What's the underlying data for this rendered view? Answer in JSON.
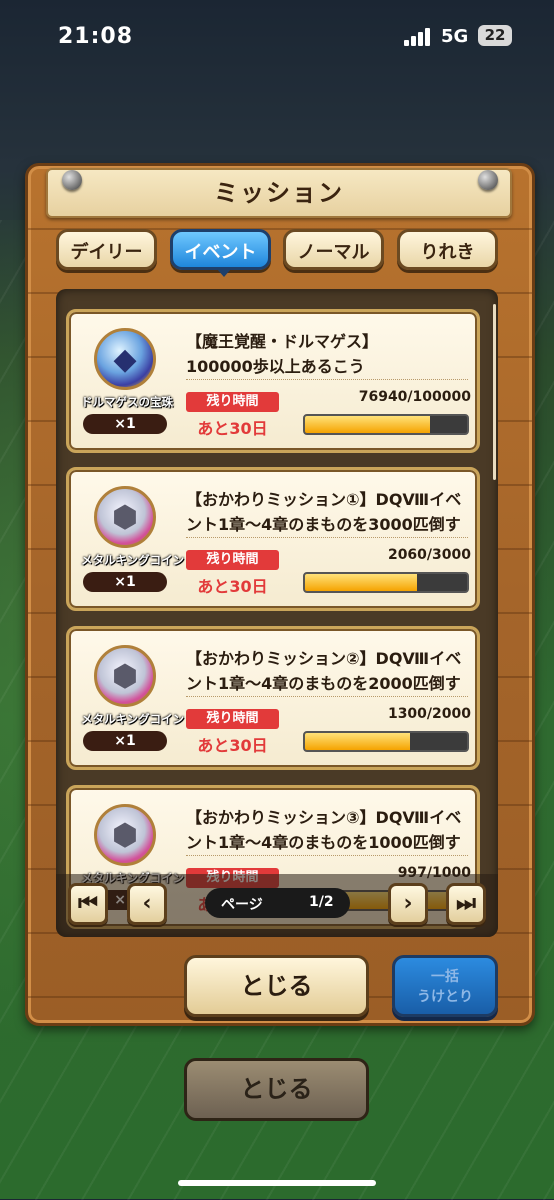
{
  "status": {
    "time": "21:08",
    "network": "5G",
    "battery": "22"
  },
  "title": "ミッション",
  "tabs": [
    {
      "label": "デイリー",
      "active": false
    },
    {
      "label": "イベント",
      "active": true
    },
    {
      "label": "ノーマル",
      "active": false
    },
    {
      "label": "りれき",
      "active": false
    }
  ],
  "missions": [
    {
      "title": "【魔王覚醒・ドルマゲス】\n100000歩以上あるこう",
      "item_name": "ドルマゲスの宝珠",
      "item_icon": "orb-icon",
      "qty": "×1",
      "remain_label": "残り時間",
      "remain": "あと30日",
      "progress_text": "76940/100000",
      "progress": 0.7694
    },
    {
      "title": "【おかわりミッション①】DQⅧイベ\nント1章～4章のまものを3000匹倒す",
      "item_name": "メタルキングコイン",
      "item_icon": "coin-icon",
      "qty": "×1",
      "remain_label": "残り時間",
      "remain": "あと30日",
      "progress_text": "2060/3000",
      "progress": 0.6867
    },
    {
      "title": "【おかわりミッション②】DQⅧイベ\nント1章～4章のまものを2000匹倒す",
      "item_name": "メタルキングコイン",
      "item_icon": "coin-icon",
      "qty": "×1",
      "remain_label": "残り時間",
      "remain": "あと30日",
      "progress_text": "1300/2000",
      "progress": 0.65
    },
    {
      "title": "【おかわりミッション③】DQⅧイベ\nント1章～4章のまものを1000匹倒す",
      "item_name": "メタルキングコイン",
      "item_icon": "coin-icon",
      "qty": "×1",
      "remain_label": "残り時間",
      "remain": "あと30日",
      "progress_text": "997/1000",
      "progress": 0.997
    }
  ],
  "pager": {
    "label": "ページ",
    "page": "1/2"
  },
  "buttons": {
    "close": "とじる",
    "collect_all": "一括\nうけとり",
    "close_under": "とじる"
  }
}
